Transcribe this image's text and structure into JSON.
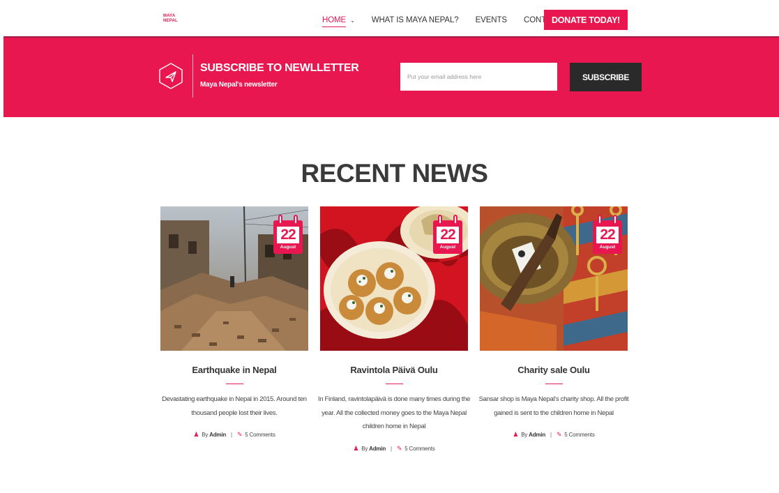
{
  "brand": {
    "logo_line1": "MAYA",
    "logo_line2": "NEPAL",
    "accent": "#e8174f"
  },
  "nav": {
    "items": [
      {
        "label": "HOME",
        "active": true
      },
      {
        "label": "WHAT IS MAYA NEPAL?"
      },
      {
        "label": "EVENTS"
      },
      {
        "label": "CONTACTS"
      }
    ],
    "donate_label": "DONATE TODAY!"
  },
  "newsletter": {
    "icon": "paper-plane-icon",
    "title": "SUBSCRIBE TO NEWLLETTER",
    "subtitle": "Maya Nepal's newsletter",
    "email_placeholder": "Put your email address here",
    "button_label": "SUBSCRIBE"
  },
  "news": {
    "title": "RECENT NEWS",
    "cards": [
      {
        "day": "22",
        "month": "August",
        "title": "Earthquake in Nepal",
        "text": "Devastating earthquake in Nepal in 2015. Around ten thousand people lost their lives.",
        "by_label": "By",
        "author": "Admin",
        "comments": "5 Comments"
      },
      {
        "day": "22",
        "month": "August",
        "title": "Ravintola Päivä Oulu",
        "text": "In Finland, ravintolapäivä is done many times during the year. All the collected money goes to the Maya Nepal children home in Nepal",
        "by_label": "By",
        "author": "Admin",
        "comments": "5 Comments"
      },
      {
        "day": "22",
        "month": "August",
        "title": "Charity sale Oulu",
        "text": "Sansar shop is Maya Nepal's charity shop. All the profit gained is sent to the children home in Nepal",
        "by_label": "By",
        "author": "Admin",
        "comments": "5 Comments"
      }
    ]
  }
}
